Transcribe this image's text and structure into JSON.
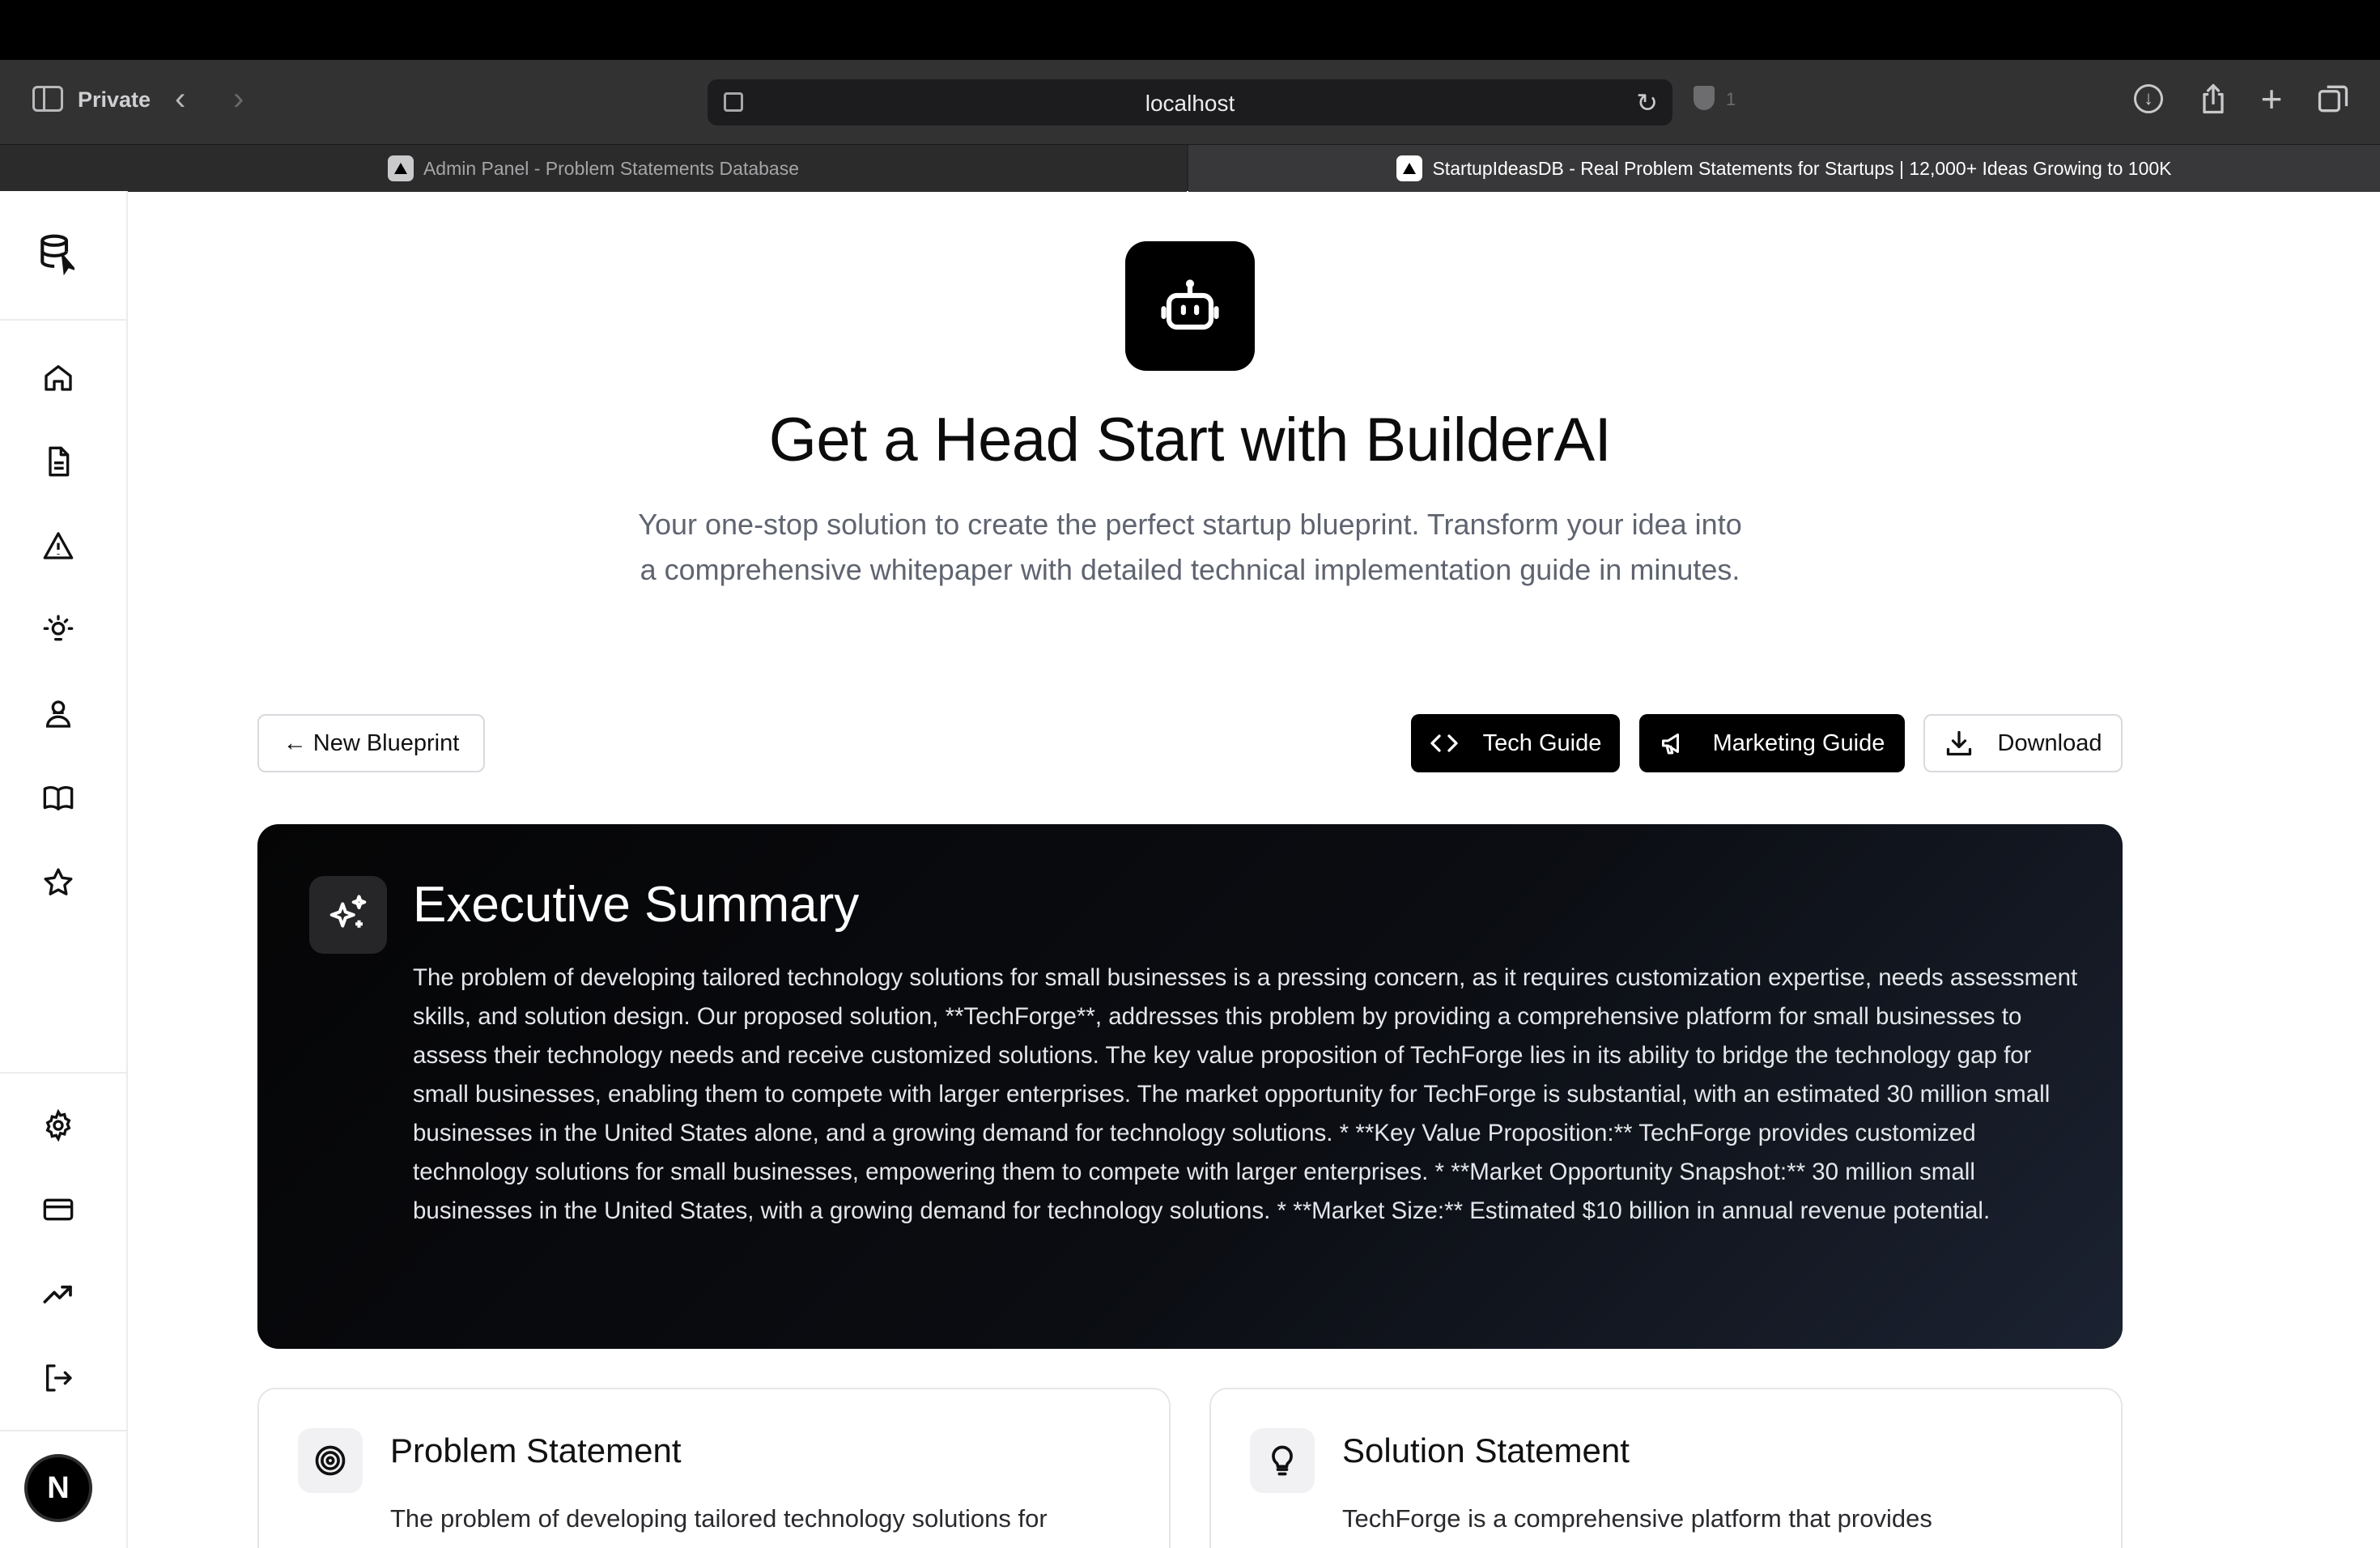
{
  "browser": {
    "mode_label": "Private",
    "url": "localhost",
    "shield_count": "1",
    "tabs": [
      {
        "title": "Admin Panel - Problem Statements Database",
        "active": false
      },
      {
        "title": "StartupIdeasDB - Real Problem Statements for Startups | 12,000+ Ideas Growing to 100K",
        "active": true
      }
    ]
  },
  "sidebar": {
    "items": [
      {
        "icon": "home-icon"
      },
      {
        "icon": "document-icon"
      },
      {
        "icon": "warning-icon"
      },
      {
        "icon": "lightbulb-icon"
      },
      {
        "icon": "users-icon"
      },
      {
        "icon": "book-icon"
      },
      {
        "icon": "star-icon"
      }
    ],
    "bottom_items": [
      {
        "icon": "gear-icon"
      },
      {
        "icon": "credit-card-icon"
      },
      {
        "icon": "trending-up-icon"
      },
      {
        "icon": "logout-icon"
      }
    ],
    "avatar_letter": "N"
  },
  "hero": {
    "icon": "bot-icon",
    "title": "Get a Head Start with BuilderAI",
    "subtitle": "Your one-stop solution to create the perfect startup blueprint. Transform your idea into a comprehensive whitepaper with detailed technical implementation guide in minutes."
  },
  "actions": {
    "new_blueprint": "← New Blueprint",
    "tech_guide": "Tech Guide",
    "marketing_guide": "Marketing Guide",
    "download": "Download"
  },
  "executive_summary": {
    "title": "Executive Summary",
    "body": "The problem of developing tailored technology solutions for small businesses is a pressing concern, as it requires customization expertise, needs assessment skills, and solution design. Our proposed solution, **TechForge**, addresses this problem by providing a comprehensive platform for small businesses to assess their technology needs and receive customized solutions. The key value proposition of TechForge lies in its ability to bridge the technology gap for small businesses, enabling them to compete with larger enterprises. The market opportunity for TechForge is substantial, with an estimated 30 million small businesses in the United States alone, and a growing demand for technology solutions. * **Key Value Proposition:** TechForge provides customized technology solutions for small businesses, empowering them to compete with larger enterprises. * **Market Opportunity Snapshot:** 30 million small businesses in the United States, with a growing demand for technology solutions. * **Market Size:** Estimated $10 billion in annual revenue potential."
  },
  "problem_statement": {
    "title": "Problem Statement",
    "text": "The problem of developing tailored technology solutions for"
  },
  "solution_statement": {
    "title": "Solution Statement",
    "text": "TechForge is a comprehensive platform that provides"
  }
}
